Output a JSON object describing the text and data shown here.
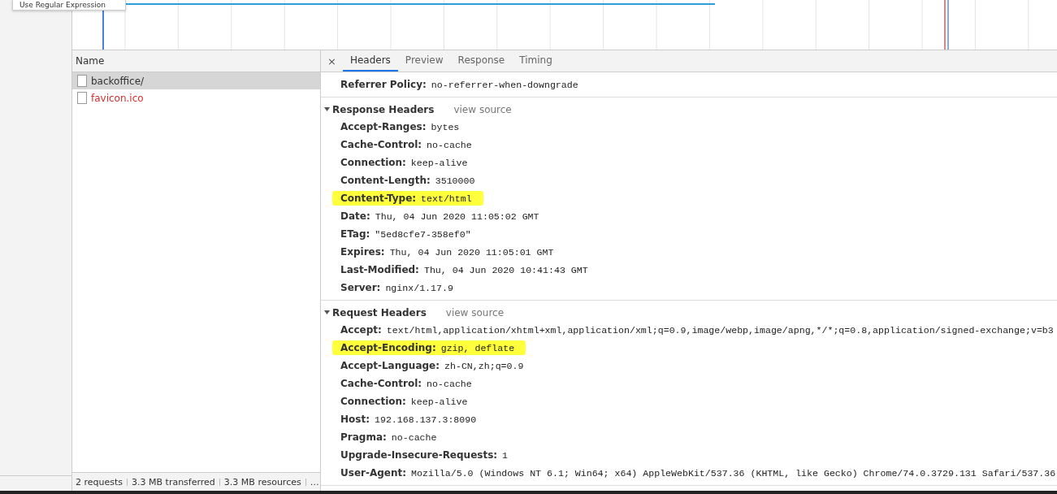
{
  "tooltip": {
    "text": "Use Regular Expression"
  },
  "requests": {
    "column": "Name",
    "items": [
      {
        "name": "backoffice/",
        "selected": true,
        "failed": false
      },
      {
        "name": "favicon.ico",
        "selected": false,
        "failed": true
      }
    ]
  },
  "status_bar": [
    "2 requests",
    "3.3 MB transferred",
    "3.3 MB resources",
    "…"
  ],
  "tabs": [
    {
      "label": "Headers",
      "selected": true
    },
    {
      "label": "Preview",
      "selected": false
    },
    {
      "label": "Response",
      "selected": false
    },
    {
      "label": "Timing",
      "selected": false
    }
  ],
  "close": "×",
  "general": [
    {
      "name": "Referrer Policy:",
      "value": "no-referrer-when-downgrade",
      "highlighted": false
    }
  ],
  "sections": [
    {
      "title": "Response Headers",
      "link": "view source",
      "expanded": true,
      "headers": [
        {
          "name": "Accept-Ranges:",
          "value": "bytes",
          "highlighted": false
        },
        {
          "name": "Cache-Control:",
          "value": "no-cache",
          "highlighted": false
        },
        {
          "name": "Connection:",
          "value": "keep-alive",
          "highlighted": false
        },
        {
          "name": "Content-Length:",
          "value": "3510000",
          "highlighted": false
        },
        {
          "name": "Content-Type:",
          "value": "text/html",
          "highlighted": true
        },
        {
          "name": "Date:",
          "value": "Thu, 04 Jun 2020 11:05:02 GMT",
          "highlighted": false
        },
        {
          "name": "ETag:",
          "value": "\"5ed8cfe7-358ef0\"",
          "highlighted": false
        },
        {
          "name": "Expires:",
          "value": "Thu, 04 Jun 2020 11:05:01 GMT",
          "highlighted": false
        },
        {
          "name": "Last-Modified:",
          "value": "Thu, 04 Jun 2020 10:41:43 GMT",
          "highlighted": false
        },
        {
          "name": "Server:",
          "value": "nginx/1.17.9",
          "highlighted": false
        }
      ]
    },
    {
      "title": "Request Headers",
      "link": "view source",
      "expanded": true,
      "headers": [
        {
          "name": "Accept:",
          "value": "text/html,application/xhtml+xml,application/xml;q=0.9,image/webp,image/apng,*/*;q=0.8,application/signed-exchange;v=b3",
          "highlighted": false
        },
        {
          "name": "Accept-Encoding:",
          "value": "gzip, deflate",
          "highlighted": true
        },
        {
          "name": "Accept-Language:",
          "value": "zh-CN,zh;q=0.9",
          "highlighted": false
        },
        {
          "name": "Cache-Control:",
          "value": "no-cache",
          "highlighted": false
        },
        {
          "name": "Connection:",
          "value": "keep-alive",
          "highlighted": false
        },
        {
          "name": "Host:",
          "value": "192.168.137.3:8090",
          "highlighted": false
        },
        {
          "name": "Pragma:",
          "value": "no-cache",
          "highlighted": false
        },
        {
          "name": "Upgrade-Insecure-Requests:",
          "value": "1",
          "highlighted": false
        },
        {
          "name": "User-Agent:",
          "value": "Mozilla/5.0 (Windows NT 6.1; Win64; x64) AppleWebKit/537.36 (KHTML, like Gecko) Chrome/74.0.3729.131 Safari/537.36",
          "highlighted": false
        }
      ]
    }
  ]
}
